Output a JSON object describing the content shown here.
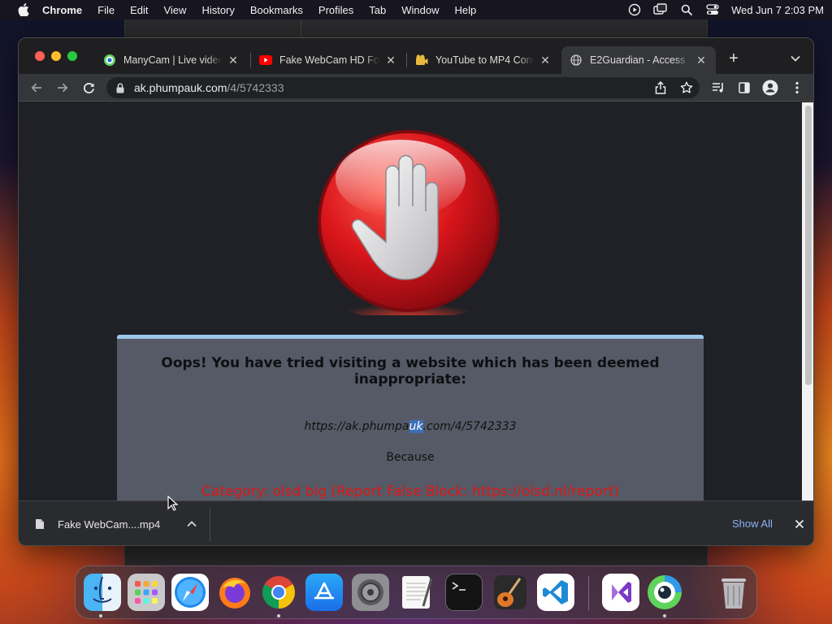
{
  "menubar": {
    "app_name": "Chrome",
    "menus": [
      "File",
      "Edit",
      "View",
      "History",
      "Bookmarks",
      "Profiles",
      "Tab",
      "Window",
      "Help"
    ],
    "clock": "Wed Jun 7  2:03 PM"
  },
  "browser": {
    "tabs": [
      {
        "title": "ManyCam | Live video",
        "favicon": "manycam-icon"
      },
      {
        "title": "Fake WebCam HD For",
        "favicon": "youtube-icon"
      },
      {
        "title": "YouTube to MP4 Conv",
        "favicon": "converter-icon"
      },
      {
        "title": "E2Guardian - Access",
        "favicon": "globe-icon",
        "active": true
      }
    ],
    "address": {
      "domain": "ak.phumpauk.com",
      "path": "/4/5742333"
    }
  },
  "page": {
    "message": "Oops! You have tried visiting a website which has been deemed inappropriate:",
    "blocked_url": {
      "pre": "https://ak.phumpa",
      "selected": "uk",
      "post": ".com/4/5742333"
    },
    "because": "Because",
    "category": "Category: olsd big (Report False Block: https://olsd.nl/report)"
  },
  "downloads": {
    "file": "Fake WebCam....mp4",
    "show_all": "Show All"
  },
  "dock": {
    "apps": [
      "Finder",
      "Launchpad",
      "Safari",
      "Firefox",
      "Chrome",
      "App Store",
      "System Settings",
      "TextEdit",
      "Terminal",
      "GarageBand",
      "Visual Studio Code",
      "Visual Studio",
      "ManyCam",
      "Trash"
    ]
  },
  "colors": {
    "accent_link": "#8ab4f8",
    "block_red": "#e01616",
    "box_border": "#9ec7ea"
  }
}
